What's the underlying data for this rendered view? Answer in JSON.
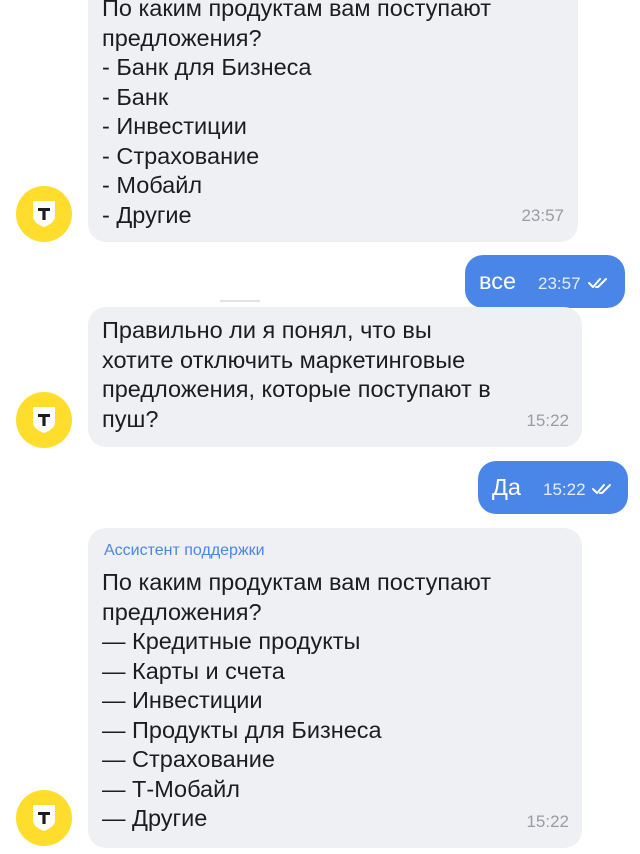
{
  "colors": {
    "incoming_bubble": "#eef0f3",
    "outgoing_bubble": "#4a86e8",
    "avatar": "#ffdd2d",
    "sender_name": "#4a86e8"
  },
  "avatar_icon": "tbank-shield-icon",
  "avatar_letter": "т",
  "messages": [
    {
      "text": "По каким продуктам вам поступают\nпредложения?\n- Банк для Бизнеса\n- Банк\n- Инвестиции\n- Страхование\n- Мобайл\n- Другие",
      "time": "23:57"
    },
    {
      "text": "все",
      "time": "23:57"
    },
    {
      "text": "Правильно ли я понял, что вы\nхотите отключить маркетинговые\nпредложения, которые поступают в\nпуш?",
      "time": "15:22"
    },
    {
      "text": "Да",
      "time": "15:22"
    },
    {
      "sender": "Ассистент поддержки",
      "text": "По каким продуктам вам поступают\nпредложения?\n— Кредитные продукты\n— Карты и счета\n— Инвестиции\n— Продукты для Бизнеса\n— Страхование\n— Т-Мобайл\n— Другие",
      "time": "15:22"
    }
  ]
}
